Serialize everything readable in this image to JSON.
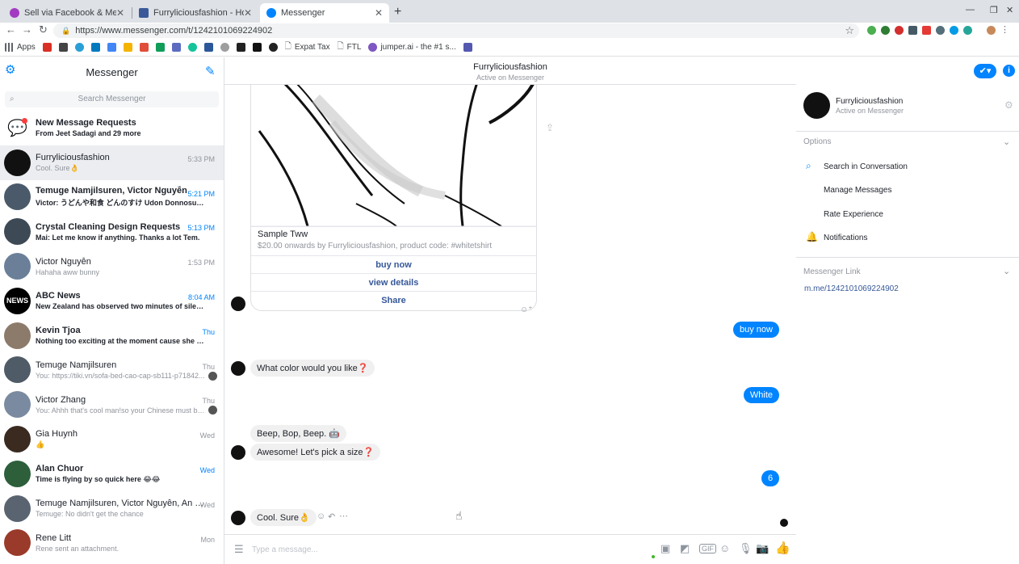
{
  "browser": {
    "tabs": [
      {
        "title": "Sell via Facebook & Messenger",
        "icon": "messenger-purple-icon",
        "active": false
      },
      {
        "title": "Furryliciousfashion - Home",
        "icon": "facebook-icon",
        "active": false
      },
      {
        "title": "Messenger",
        "icon": "messenger-icon",
        "active": true
      }
    ],
    "url": "https://www.messenger.com/t/1242101069224902",
    "bookmarks": [
      {
        "label": "Apps"
      },
      {
        "label": ""
      },
      {
        "label": "Expat Tax"
      },
      {
        "label": "FTL"
      },
      {
        "label": "jumper.ai - the #1 s..."
      }
    ]
  },
  "sidebar": {
    "title": "Messenger",
    "search_placeholder": "Search Messenger",
    "requests": {
      "title": "New Message Requests",
      "subtitle": "From Jeet Sadagi and 29 more"
    },
    "conversations": [
      {
        "name": "Furryliciousfashion",
        "snippet": "Cool. Sure👌",
        "time": "5:33 PM",
        "unread": false,
        "selected": true,
        "avatar_color": "#111111"
      },
      {
        "name": "Temuge Namjilsuren, Victor Nguyễn",
        "snippet": "Victor: うどんや和食 どんのすけ Udon Donnosuke...",
        "time": "5:21 PM",
        "unread": true,
        "avatar_color": "#4a5a6a"
      },
      {
        "name": "Crystal Cleaning Design Requests",
        "snippet": "Mai: Let me know if anything. Thanks a lot Tem.",
        "time": "5:13 PM",
        "unread": true,
        "avatar_color": "#3d4a55"
      },
      {
        "name": "Victor Nguyễn",
        "snippet": "Hahaha aww bunny",
        "time": "1:53 PM",
        "unread": false,
        "avatar_color": "#6b7f99"
      },
      {
        "name": "ABC News",
        "snippet": "New Zealand has observed two minutes of silenc...",
        "time": "8:04 AM",
        "unread": true,
        "avatar_color": "#000000",
        "avatar_text": "NEWS"
      },
      {
        "name": "Kevin Tjoa",
        "snippet": "Nothing too exciting at the moment cause she is ...",
        "time": "Thu",
        "unread": true,
        "avatar_color": "#8c7a6a"
      },
      {
        "name": "Temuge Namjilsuren",
        "snippet": "You: https://tiki.vn/sofa-bed-cao-cap-sb111-p71842...",
        "time": "Thu",
        "unread": false,
        "avatar_color": "#4f5b66"
      },
      {
        "name": "Victor Zhang",
        "snippet": "You: Ahhh that's cool man!so your Chinese must be ...",
        "time": "Thu",
        "unread": false,
        "avatar_color": "#7a8aa0"
      },
      {
        "name": "Gia Huynh",
        "snippet": "👍",
        "time": "Wed",
        "unread": false,
        "avatar_color": "#3a2a20"
      },
      {
        "name": "Alan Chuor",
        "snippet": "Time is flying by so quick here 😂😂",
        "time": "Wed",
        "unread": true,
        "avatar_color": "#2c5f3a"
      },
      {
        "name": "Temuge Namjilsuren, Victor Nguyễn, An K Tr...",
        "snippet": "Temuge: No didn't get the chance",
        "time": "Wed",
        "unread": false,
        "avatar_color": "#5a6470"
      },
      {
        "name": "Rene Litt",
        "snippet": "Rene sent an attachment.",
        "time": "Mon",
        "unread": false,
        "avatar_color": "#9a3a2a"
      }
    ]
  },
  "chat": {
    "name": "Furryliciousfashion",
    "status": "Active on Messenger",
    "card": {
      "title": "Sample Tww",
      "subtitle": "$20.00 onwards by Furryliciousfashion, product code: #whitetshirt",
      "buttons": [
        "buy now",
        "view details",
        "Share"
      ]
    },
    "messages": [
      {
        "from": "me",
        "text": "buy now"
      },
      {
        "from": "them",
        "text": "What color would you like❓"
      },
      {
        "from": "me",
        "text": "White"
      },
      {
        "from": "them",
        "text": "Beep, Bop, Beep. 🤖"
      },
      {
        "from": "them",
        "text": "Awesome! Let's pick a size❓"
      },
      {
        "from": "me",
        "text": "6"
      },
      {
        "from": "them",
        "text": "Cool. Sure👌"
      }
    ],
    "composer_placeholder": "Type a message..."
  },
  "details": {
    "name": "Furryliciousfashion",
    "status": "Active on Messenger",
    "options_label": "Options",
    "options": [
      {
        "label": "Search in Conversation",
        "icon": "search-icon"
      },
      {
        "label": "Manage Messages",
        "icon": ""
      },
      {
        "label": "Rate Experience",
        "icon": ""
      },
      {
        "label": "Notifications",
        "icon": "bell-icon"
      }
    ],
    "link_label": "Messenger Link",
    "link": "m.me/1242101069224902"
  },
  "colors": {
    "accent": "#0084ff",
    "link": "#365899"
  }
}
